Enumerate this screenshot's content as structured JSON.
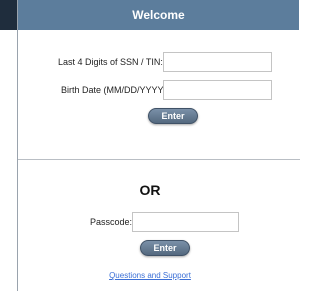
{
  "header": {
    "title": "Welcome"
  },
  "form": {
    "ssn_label": "Last 4 Digits of SSN / TIN:",
    "ssn_value": "",
    "birth_label": "Birth Date (MM/DD/YYYY):",
    "birth_value": "",
    "enter_label": "Enter"
  },
  "alt": {
    "or_label": "OR",
    "passcode_label": "Passcode:",
    "passcode_value": "",
    "enter_label": "Enter"
  },
  "footer": {
    "help_link": "Questions and Support"
  }
}
